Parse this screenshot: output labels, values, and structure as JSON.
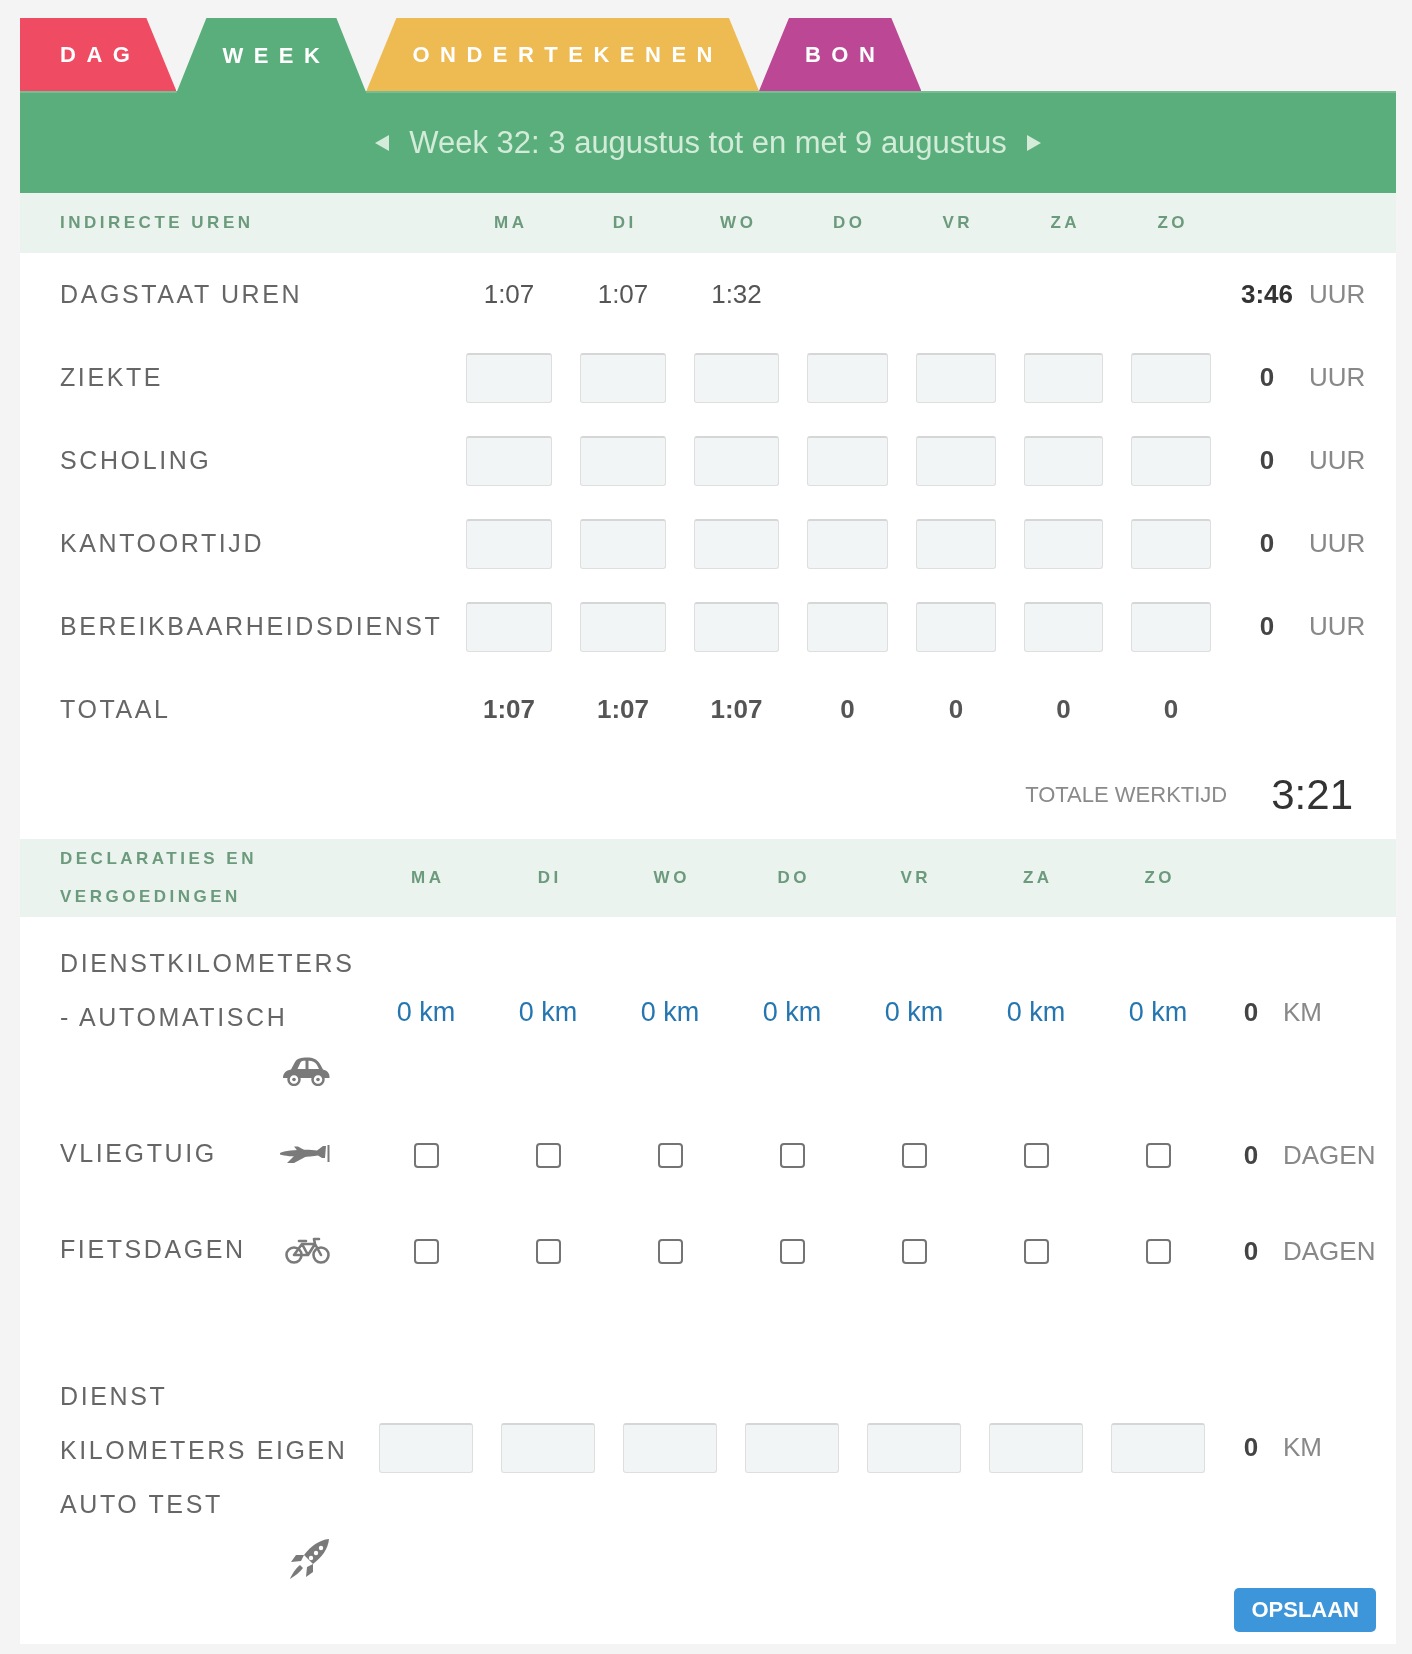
{
  "tabs": [
    {
      "label": "DAG",
      "color": "#ef4b63",
      "selected": false
    },
    {
      "label": "WEEK",
      "color": "#59ae7b",
      "selected": true
    },
    {
      "label": "ONDERTEKENEN",
      "color": "#eeba52",
      "selected": false
    },
    {
      "label": "BON",
      "color": "#bc4895",
      "selected": false
    }
  ],
  "week_navigation": {
    "title": "Week 32: 3 augustus tot en met 9 augustus"
  },
  "indirect_hours": {
    "heading": "INDIRECTE UREN",
    "days": [
      "MA",
      "DI",
      "WO",
      "DO",
      "VR",
      "ZA",
      "ZO"
    ],
    "rows": [
      {
        "kind": "reading",
        "label": "DAGSTAAT UREN",
        "values": [
          "1:07",
          "1:07",
          "1:32"
        ],
        "total": "3:46",
        "unit": "UUR"
      },
      {
        "kind": "input",
        "label": "ZIEKTE",
        "total": "0",
        "unit": "UUR"
      },
      {
        "kind": "input",
        "label": "SCHOLING",
        "total": "0",
        "unit": "UUR"
      },
      {
        "kind": "input",
        "label": "KANTOORTIJD",
        "total": "0",
        "unit": "UUR"
      },
      {
        "kind": "input",
        "label": "BEREIKBAARHEIDSDIENST",
        "total": "0",
        "unit": "UUR"
      },
      {
        "kind": "total",
        "label": "TOTAAL",
        "values": [
          "1:07",
          "1:07",
          "1:07",
          "0",
          "0",
          "0",
          "0"
        ]
      }
    ],
    "total_worktime": {
      "label": "TOTALE WERKTIJD",
      "value": "3:21"
    }
  },
  "declarations": {
    "heading": "DECLARATIES EN VERGOEDINGEN",
    "days": [
      "MA",
      "DI",
      "WO",
      "DO",
      "VR",
      "ZA",
      "ZO"
    ],
    "rows": [
      {
        "kind": "distance",
        "label": "DIENSTKILOMETERS - AUTOMATISCH",
        "values": [
          "0 km",
          "0 km",
          "0 km",
          "0 km",
          "0 km",
          "0 km",
          "0 km"
        ],
        "total": "0",
        "unit": "KM"
      },
      {
        "kind": "checkbox",
        "label": "VLIEGTUIG",
        "checked": [
          false,
          false,
          false,
          false,
          false,
          false,
          false
        ],
        "total": "0",
        "unit": "DAGEN"
      },
      {
        "kind": "checkbox",
        "label": "FIETSDAGEN",
        "checked": [
          false,
          false,
          false,
          false,
          false,
          false,
          false
        ],
        "total": "0",
        "unit": "DAGEN"
      },
      {
        "kind": "input",
        "label": "DIENST KILOMETERS EIGEN AUTO TEST",
        "total": "0",
        "unit": "KM"
      }
    ]
  },
  "save_button": {
    "label": "OPSLAAN"
  }
}
